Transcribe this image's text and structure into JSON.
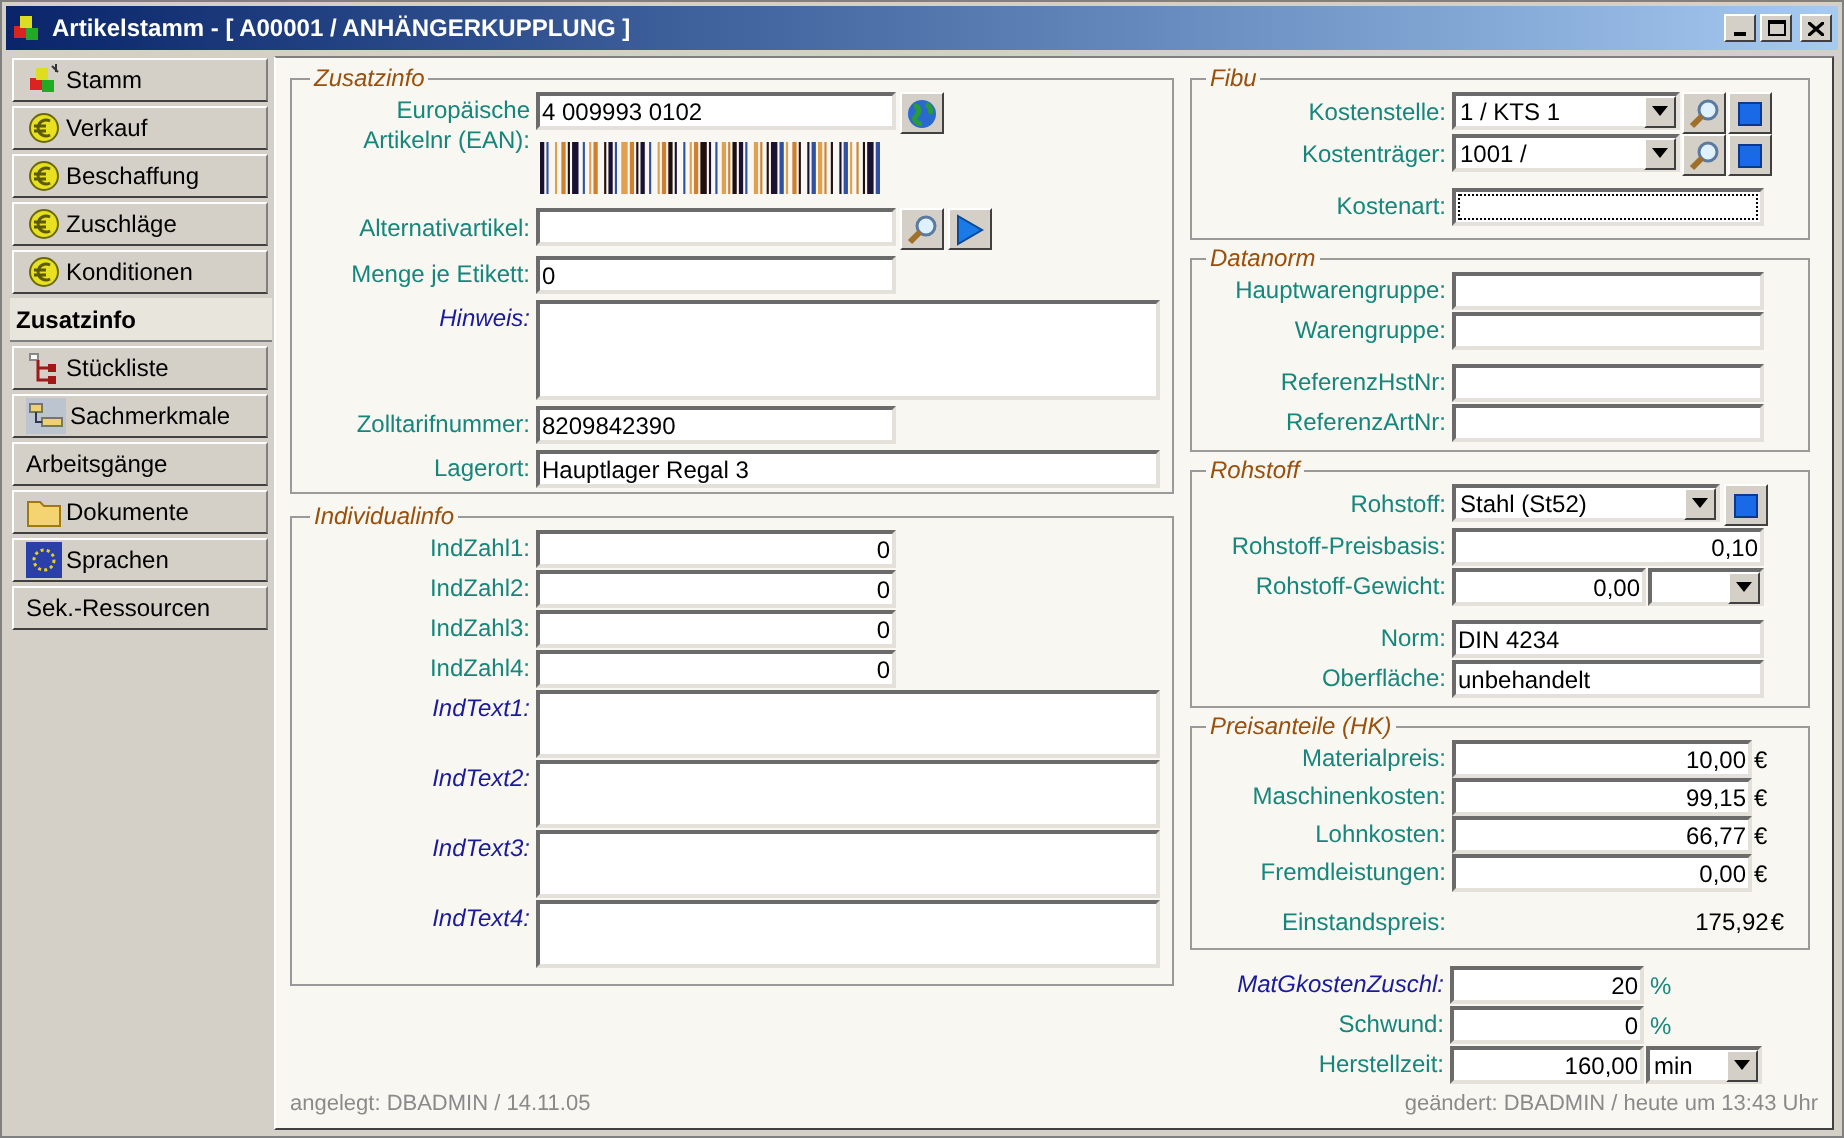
{
  "window": {
    "title": "Artikelstamm - [ A00001 / ANHÄNGERKUPPLUNG ]"
  },
  "sidebar": {
    "items": [
      {
        "label": "Stamm",
        "kind": "module",
        "selected": false
      },
      {
        "label": "Verkauf",
        "kind": "pricing",
        "selected": false
      },
      {
        "label": "Beschaffung",
        "kind": "pricing",
        "selected": false
      },
      {
        "label": "Zuschläge",
        "kind": "pricing",
        "selected": false
      },
      {
        "label": "Konditionen",
        "kind": "pricing",
        "selected": false
      },
      {
        "label": "Zusatzinfo",
        "kind": "plain",
        "selected": true
      },
      {
        "label": "Stückliste",
        "kind": "bom",
        "selected": false
      },
      {
        "label": "Sachmerkmale",
        "kind": "features",
        "selected": false
      },
      {
        "label": "Arbeitsgänge",
        "kind": "plain",
        "selected": false
      },
      {
        "label": "Dokumente",
        "kind": "folder",
        "selected": false
      },
      {
        "label": "Sprachen",
        "kind": "language",
        "selected": false
      },
      {
        "label": "Sek.-Ressourcen",
        "kind": "plain",
        "selected": false
      }
    ]
  },
  "zusatzinfo": {
    "title": "Zusatzinfo",
    "fields": [
      {
        "label": "Europäische Artikelnr (EAN):",
        "kind": "ean",
        "value": "4 009993 0102",
        "italic": false
      },
      {
        "label": "Alternativartikel:",
        "kind": "lookup",
        "italic": false
      },
      {
        "label": "Menge je Etikett:",
        "kind": "short",
        "value": "0",
        "italic": false
      },
      {
        "label": "Hinweis:",
        "kind": "memo",
        "italic": true
      },
      {
        "label": "Zolltarifnummer:",
        "kind": "short",
        "value": "8209842390",
        "italic": false
      },
      {
        "label": "Lagerort:",
        "kind": "long",
        "value": "Hauptlager Regal 3",
        "italic": false
      }
    ]
  },
  "individualinfo": {
    "title": "Individualinfo",
    "fields": [
      {
        "label": "IndZahl1:",
        "kind": "number",
        "value": "0",
        "italic": false
      },
      {
        "label": "IndZahl2:",
        "kind": "number",
        "value": "0",
        "italic": false
      },
      {
        "label": "IndZahl3:",
        "kind": "number",
        "value": "0",
        "italic": false
      },
      {
        "label": "IndZahl4:",
        "kind": "number",
        "value": "0",
        "italic": false
      },
      {
        "label": "IndText1:",
        "kind": "memo",
        "italic": true
      },
      {
        "label": "IndText2:",
        "kind": "memo",
        "italic": true
      },
      {
        "label": "IndText3:",
        "kind": "memo",
        "italic": true
      },
      {
        "label": "IndText4:",
        "kind": "memo",
        "italic": true
      }
    ]
  },
  "fibu": {
    "title": "Fibu",
    "fields": [
      {
        "label": "Kostenstelle:",
        "kind": "combo-lookup",
        "value": "1 / KTS 1",
        "focused": false
      },
      {
        "label": "Kostenträger:",
        "kind": "combo-lookup",
        "value": "1001 /",
        "focused": false
      },
      {
        "label": "Kostenart:",
        "kind": "text",
        "focused": true
      }
    ]
  },
  "datanorm": {
    "title": "Datanorm",
    "fields": [
      {
        "label": "Hauptwarengruppe:",
        "kind": "text"
      },
      {
        "label": "Warengruppe:",
        "kind": "text"
      },
      {
        "label": "ReferenzHstNr:",
        "kind": "text"
      },
      {
        "label": "ReferenzArtNr:",
        "kind": "text"
      }
    ]
  },
  "rohstoff": {
    "title": "Rohstoff",
    "fields": [
      {
        "label": "Rohstoff:",
        "kind": "combo-button",
        "value": "Stahl (St52)"
      },
      {
        "label": "Rohstoff-Preisbasis:",
        "kind": "number",
        "value": "0,10"
      },
      {
        "label": "Rohstoff-Gewicht:",
        "kind": "number-combo",
        "value": "0,00"
      },
      {
        "label": "Norm:",
        "kind": "text",
        "value": "DIN 4234"
      },
      {
        "label": "Oberfläche:",
        "kind": "text",
        "value": "unbehandelt"
      }
    ]
  },
  "preisanteile": {
    "title": "Preisanteile (HK)",
    "fields": [
      {
        "label": "Materialpreis:",
        "kind": "money",
        "value": "10,00",
        "unit": "€"
      },
      {
        "label": "Maschinenkosten:",
        "kind": "money",
        "value": "99,15",
        "unit": "€"
      },
      {
        "label": "Lohnkosten:",
        "kind": "money",
        "value": "66,77",
        "unit": "€"
      },
      {
        "label": "Fremdleistungen:",
        "kind": "money",
        "value": "0,00",
        "unit": "€"
      },
      {
        "label": "Einstandspreis:",
        "kind": "total",
        "value": "175,92",
        "unit": "€"
      }
    ]
  },
  "extras": {
    "fields": [
      {
        "label": "MatGkostenZuschl:",
        "kind": "number-unit",
        "value": "20",
        "unit": "%",
        "italic": true
      },
      {
        "label": "Schwund:",
        "kind": "number-unit",
        "value": "0",
        "unit": "%",
        "italic": false
      },
      {
        "label": "Herstellzeit:",
        "kind": "number-combo",
        "value": "160,00",
        "option": "min",
        "italic": false
      }
    ]
  },
  "footer": {
    "created": "angelegt: DBADMIN / 14.11.05",
    "changed": "geändert: DBADMIN / heute um 13:43 Uhr"
  }
}
